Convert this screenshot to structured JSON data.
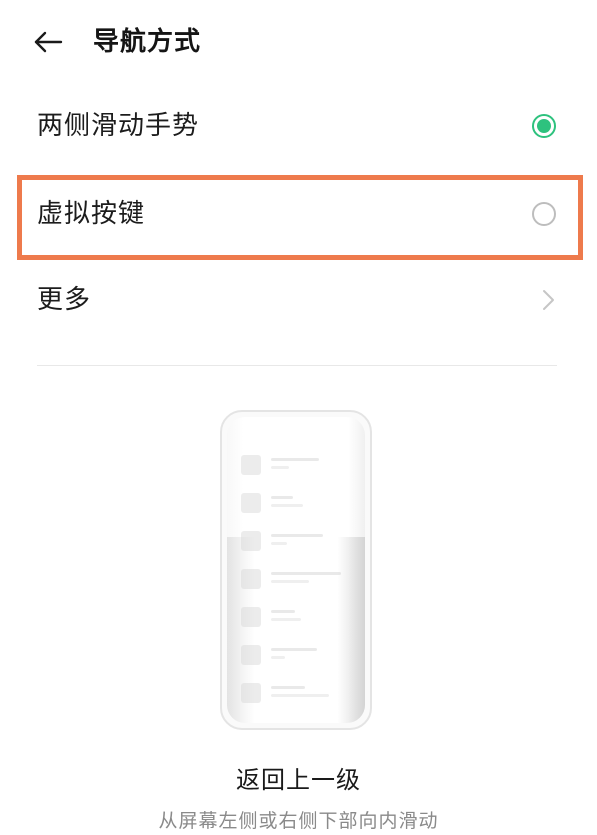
{
  "header": {
    "back_icon": "arrow-left-icon",
    "title": "导航方式"
  },
  "options": [
    {
      "label": "两侧滑动手势",
      "control": "radio",
      "selected": true
    },
    {
      "label": "虚拟按键",
      "control": "radio",
      "selected": false
    },
    {
      "label": "更多",
      "control": "chevron",
      "icon": "chevron-right-icon"
    }
  ],
  "colors": {
    "accent_green": "#2ec27e",
    "highlight_orange": "#ee7a4c",
    "radio_unchecked": "#bdbdbd",
    "chevron_gray": "#c6c6c6",
    "subtitle_gray": "#8a8a8a"
  },
  "preview": {
    "illustration": "phone-gesture-illustration",
    "title": "返回上一级",
    "description": "从屏幕左侧或右侧下部向内滑动"
  }
}
